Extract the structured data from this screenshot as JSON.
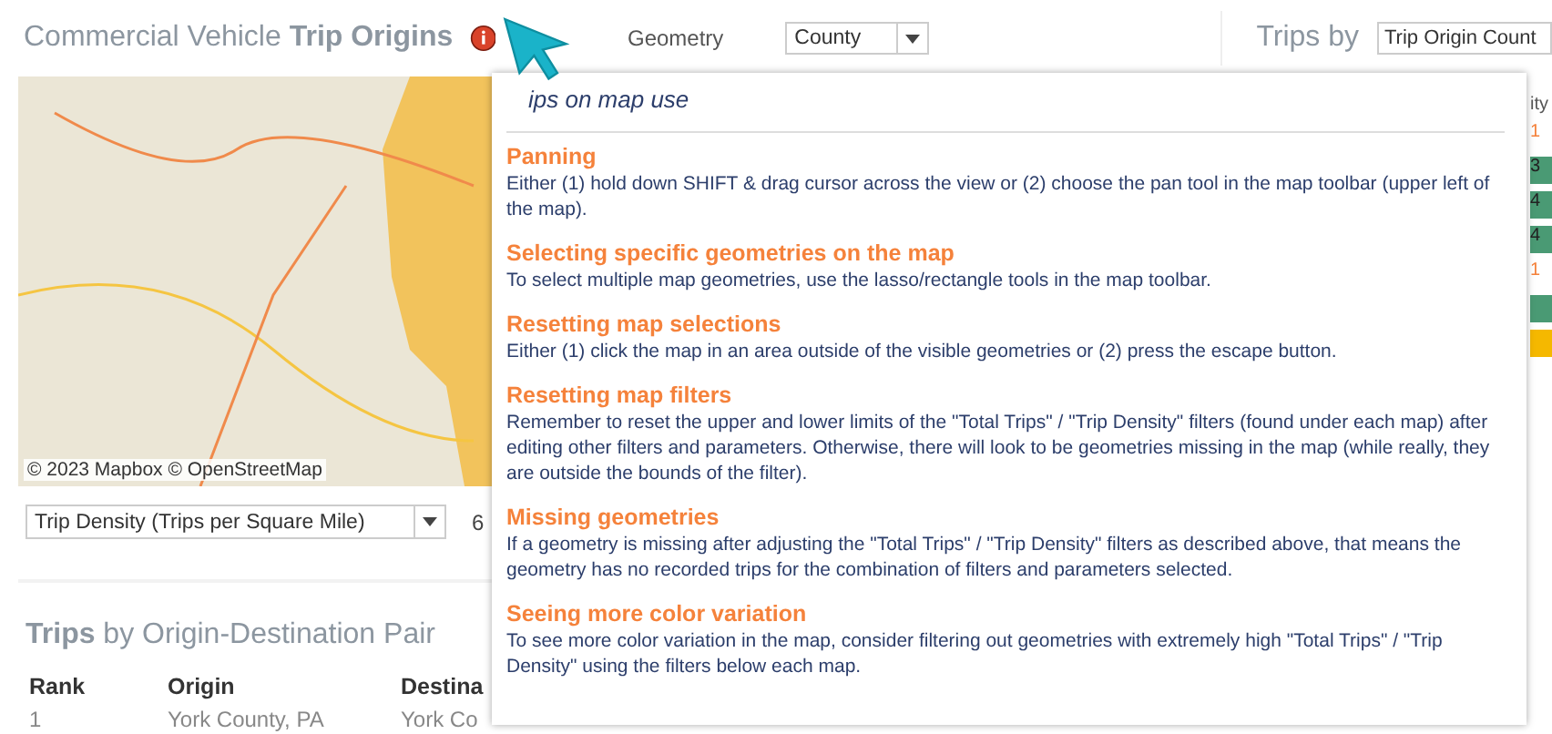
{
  "header": {
    "title": "Commercial Vehicle **Trip Origins**",
    "geometry_label": "Geometry",
    "geometry_value": "County",
    "trips_by_label": "Trips by",
    "trips_by_value": "Trip Origin Count"
  },
  "map": {
    "attribution": "© 2023 Mapbox © OpenStreetMap"
  },
  "measure": {
    "value": "Trip Density (Trips per Square Mile)",
    "range_start": "6"
  },
  "pairs": {
    "title": "**Trips** by Origin-Destination Pair",
    "columns": [
      "Rank",
      "Origin",
      "Destina"
    ],
    "rows": [
      [
        "1",
        "York County, PA",
        "York Co"
      ]
    ]
  },
  "side_list": {
    "header": "ity",
    "rows": [
      {
        "text": "1",
        "kind": "text",
        "color": "#f5823b"
      },
      {
        "text": "3",
        "kind": "bar",
        "color": "#4a9a74"
      },
      {
        "text": "4",
        "kind": "bar",
        "color": "#4a9a74"
      },
      {
        "text": "4",
        "kind": "bar",
        "color": "#4a9a74"
      },
      {
        "text": "1",
        "kind": "text",
        "color": "#f5823b"
      },
      {
        "text": "",
        "kind": "bar",
        "color": "#4a9a74"
      },
      {
        "text": "",
        "kind": "bar",
        "color": "#f5b800"
      }
    ]
  },
  "tips": {
    "title": "ips on map use",
    "sections": [
      {
        "heading": "Panning",
        "body": "Either (1) hold down SHIFT & drag cursor across the view or (2) choose the pan tool in the map toolbar (upper left of the map)."
      },
      {
        "heading": "Selecting specific geometries on the map",
        "body": "To select multiple map geometries, use the lasso/rectangle tools in the map toolbar."
      },
      {
        "heading": "Resetting map selections",
        "body": "Either (1) click the map in an area outside of the visible geometries or (2) press the escape button."
      },
      {
        "heading": "Resetting map filters",
        "body": "Remember to reset the upper and lower limits of the \"Total Trips\" / \"Trip Density\" filters (found under each map) after editing other filters and parameters. Otherwise, there will look to be geometries missing in the map (while really, they are outside the bounds of the filter)."
      },
      {
        "heading": "Missing geometries",
        "body": "If a geometry is missing after adjusting the \"Total Trips\" / \"Trip Density\" filters as described above, that means the geometry has no recorded trips for the combination of filters and parameters selected."
      },
      {
        "heading": "Seeing more color variation",
        "body": "To see more color variation in the map, consider filtering out geometries with extremely high \"Total Trips\" / \"Trip Density\" using the filters below each map."
      }
    ]
  }
}
